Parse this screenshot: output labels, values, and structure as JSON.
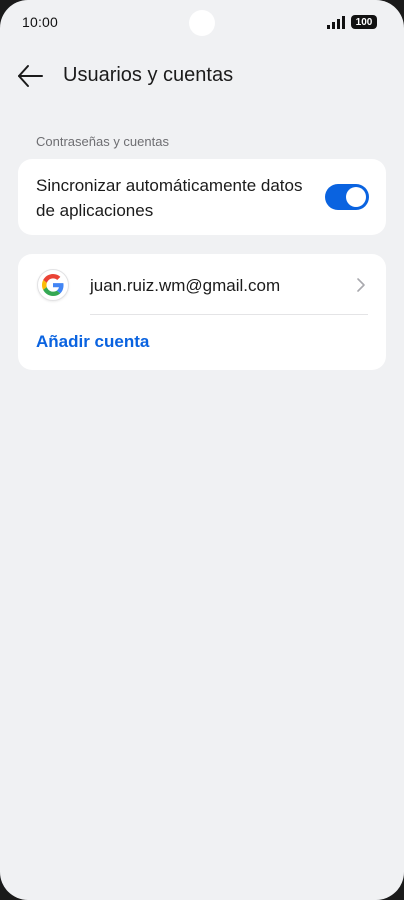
{
  "status_bar": {
    "time": "10:00",
    "battery": "100",
    "icons": [
      "signal-icon",
      "battery-icon"
    ]
  },
  "header": {
    "back_icon": "back-arrow-icon",
    "title": "Usuarios y cuentas"
  },
  "section": {
    "label": "Contraseñas y cuentas"
  },
  "sync": {
    "label": "Sincronizar automáticamente datos de aplicaciones",
    "enabled": true
  },
  "accounts": {
    "items": [
      {
        "icon": "google-icon",
        "email": "juan.ruiz.wm@gmail.com"
      }
    ],
    "add_label": "Añadir cuenta"
  },
  "colors": {
    "accent": "#0a63e0",
    "background": "#f0f1f3",
    "card": "#ffffff"
  }
}
